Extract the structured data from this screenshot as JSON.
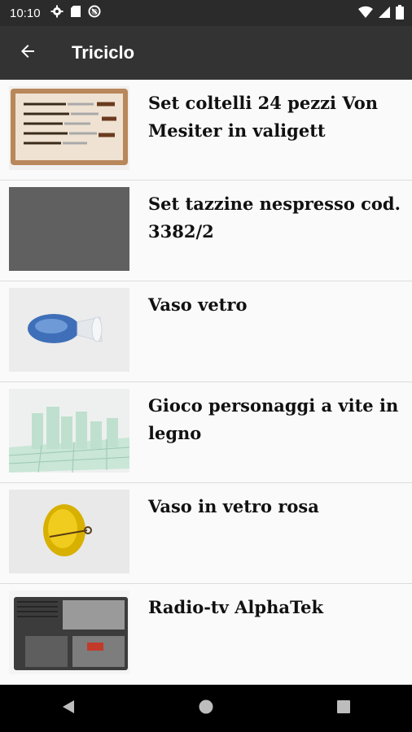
{
  "status": {
    "time": "10:10",
    "left_icons": [
      "settings-icon",
      "sd-card-icon",
      "do-not-disturb-icon"
    ],
    "right_icons": [
      "wifi-icon",
      "signal-icon",
      "battery-icon"
    ]
  },
  "appbar": {
    "title": "Triciclo",
    "back_icon": "arrow-back-icon"
  },
  "items": [
    {
      "label": "Set coltelli 24 pezzi Von Mesiter in valigett",
      "image": "knife-set-case"
    },
    {
      "label": "Set tazzine nespresso cod. 3382/2",
      "image": "placeholder-gray"
    },
    {
      "label": "Vaso vetro",
      "image": "blue-glass-vase"
    },
    {
      "label": "Gioco personaggi a vite in legno",
      "image": "glass-chess-set"
    },
    {
      "label": "Vaso in vetro rosa",
      "image": "yellow-glass-plate"
    },
    {
      "label": "Radio-tv AlphaTek",
      "image": "portable-radio-tv"
    }
  ],
  "navbar": {
    "buttons": [
      "back-triangle-icon",
      "home-circle-icon",
      "recents-square-icon"
    ]
  }
}
